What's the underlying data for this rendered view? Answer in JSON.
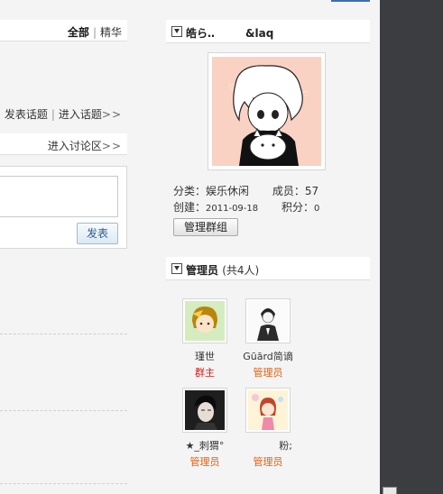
{
  "filter": {
    "all": "全部",
    "separator": "|",
    "featured": "精华"
  },
  "topic_links": {
    "post": "发表话题",
    "separator": "|",
    "enter": "进入话题",
    "arrows": ">>"
  },
  "discussion": {
    "enter": "进入讨论区",
    "arrows": ">>"
  },
  "composer": {
    "submit_label": "发表"
  },
  "group": {
    "title_part1": "皓ら‥",
    "title_part2": "&laq",
    "category_label": "分类：",
    "category_value": "娱乐休闲",
    "members_label": "成员：",
    "members_value": "57",
    "created_label": "创建：",
    "created_value": "2011-09-18",
    "points_label": "积分：",
    "points_value": "0",
    "manage_label": "管理群组"
  },
  "admins": {
    "title": "管理员",
    "count": "(共4人)",
    "list": [
      {
        "name": "瑾世",
        "role": "群主"
      },
      {
        "name": "Gūārd简谪",
        "role": "管理员"
      },
      {
        "name": "★_刺猬°",
        "role": "管理员"
      },
      {
        "name": "粉;",
        "role": "管理员"
      }
    ]
  },
  "colors": {
    "owner_role": "#d41a1a",
    "admin_role": "#e06010",
    "accent_blue": "#3b6fb6",
    "dark_panel": "#3c3d40"
  }
}
